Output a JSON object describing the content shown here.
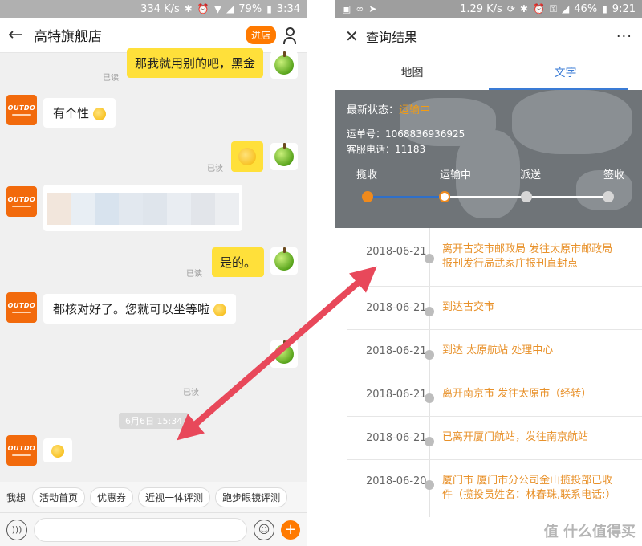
{
  "left": {
    "status": {
      "speed": "334 K/s",
      "battery": "79%",
      "time": "3:34"
    },
    "header": {
      "title": "高特旗舰店",
      "enter_label": "进店"
    },
    "messages": {
      "m1": "那我就用别的吧，黑金",
      "m2": "有个性",
      "m4": "是的。",
      "m5": "都核对好了。您就可以坐等啦"
    },
    "read_label": "已读",
    "timestamp": "6月6日 15:34",
    "quick_bar": {
      "label": "我想",
      "chips": [
        "活动首页",
        "优惠券",
        "近视一体评测",
        "跑步眼镜评测"
      ]
    },
    "avatar_logo": "OUTDO"
  },
  "right": {
    "status": {
      "speed": "1.29 K/s",
      "battery": "46%",
      "time": "9:21"
    },
    "header": {
      "title": "查询结果",
      "more": "···"
    },
    "tabs": [
      "地图",
      "文字"
    ],
    "map": {
      "status_label": "最新状态：",
      "status_value": "运输中",
      "waybill_label": "运单号：",
      "waybill": "1068836936925",
      "phone_label": "客服电话：",
      "phone": "11183",
      "steps": [
        "揽收",
        "运输中",
        "派送",
        "签收"
      ],
      "current_step": 1
    },
    "timeline": [
      {
        "date": "2018-06-21",
        "text": "离开古交市邮政局 发往太原市邮政局报刊发行局武家庄报刊直封点"
      },
      {
        "date": "2018-06-21",
        "text": "到达古交市"
      },
      {
        "date": "2018-06-21",
        "text": "到达 太原航站 处理中心"
      },
      {
        "date": "2018-06-21",
        "text": "离开南京市 发往太原市（经转）"
      },
      {
        "date": "2018-06-21",
        "text": "已离开厦门航站，发往南京航站"
      },
      {
        "date": "2018-06-20",
        "text": "厦门市 厦门市分公司金山揽投部已收件（揽投员姓名：林春珠,联系电话:）"
      }
    ],
    "watermark": "值 什么值得买"
  },
  "colors": {
    "accent_orange": "#ff7a00",
    "bubble_yellow": "#ffe03a",
    "tab_blue": "#3a7bd5",
    "timeline_text": "#e8912a",
    "arrow_red": "#e8485a"
  }
}
